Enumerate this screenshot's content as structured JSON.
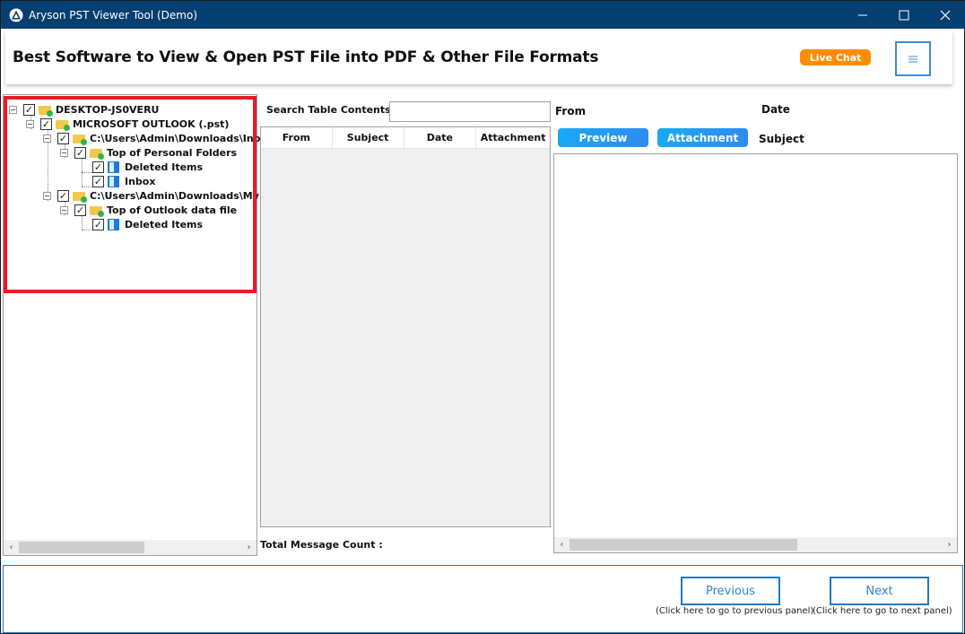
{
  "window": {
    "title": "Aryson PST Viewer Tool (Demo)",
    "icons": {
      "app": "aryson-logo-icon",
      "minimize": "minimize-icon",
      "maximize": "maximize-icon",
      "close": "close-icon"
    }
  },
  "banner": {
    "headline": "Best Software to View & Open PST File into PDF & Other File Formats",
    "live_chat_label": "Live Chat",
    "menu_icon": "hamburger-icon",
    "live_chat_color": "#ff8c00"
  },
  "tree": {
    "nodes": [
      {
        "label": "DESKTOP-JS0VERU",
        "checked": true,
        "icon": "folder-icon",
        "level": 0
      },
      {
        "label": "MICROSOFT OUTLOOK (.pst)",
        "checked": true,
        "icon": "folder-icon",
        "level": 1
      },
      {
        "label": "C:\\Users\\Admin\\Downloads\\Inb",
        "checked": true,
        "icon": "folder-icon",
        "level": 2
      },
      {
        "label": "Top of Personal Folders",
        "checked": true,
        "icon": "folder-icon",
        "level": 3
      },
      {
        "label": "Deleted Items",
        "checked": true,
        "icon": "mail-folder-icon",
        "level": 4
      },
      {
        "label": "Inbox",
        "checked": true,
        "icon": "mail-folder-icon",
        "level": 4
      },
      {
        "label": "C:\\Users\\Admin\\Downloads\\My",
        "checked": true,
        "icon": "folder-icon",
        "level": 2
      },
      {
        "label": "Top of Outlook data file",
        "checked": true,
        "icon": "folder-icon",
        "level": 3
      },
      {
        "label": "Deleted Items",
        "checked": true,
        "icon": "mail-folder-icon",
        "level": 4
      }
    ],
    "highlight_color": "#e81c27"
  },
  "messages": {
    "search_label": "Search Table Contents:",
    "search_value": "",
    "columns": [
      "From",
      "Subject",
      "Date",
      "Attachment"
    ],
    "rows": [],
    "total_count_label": "Total Message Count :"
  },
  "preview": {
    "from_label": "From",
    "date_label": "Date",
    "subject_label": "Subject",
    "preview_button": "Preview",
    "attachment_button": "Attachment"
  },
  "footer": {
    "previous_label": "Previous",
    "previous_hint": "(Click here to go to previous panel)",
    "next_label": "Next",
    "next_hint": "(Click here to go to next panel)",
    "accent_color": "#1f79c4"
  }
}
